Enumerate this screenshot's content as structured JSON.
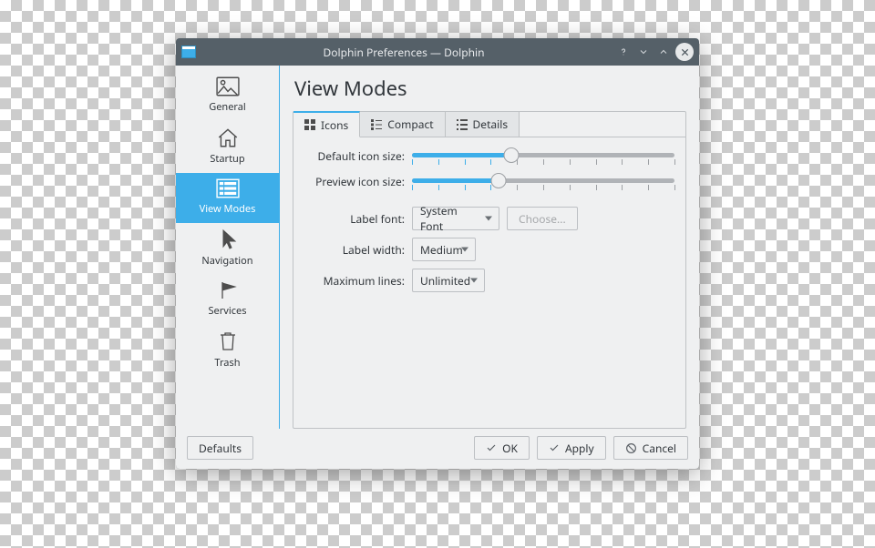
{
  "window": {
    "title": "Dolphin Preferences — Dolphin"
  },
  "sidebar": {
    "items": [
      {
        "label": "General"
      },
      {
        "label": "Startup"
      },
      {
        "label": "View Modes"
      },
      {
        "label": "Navigation"
      },
      {
        "label": "Services"
      },
      {
        "label": "Trash"
      }
    ]
  },
  "main": {
    "heading": "View Modes",
    "tabs": [
      {
        "label": "Icons"
      },
      {
        "label": "Compact"
      },
      {
        "label": "Details"
      }
    ],
    "fields": {
      "default_icon_size_label": "Default icon size:",
      "preview_icon_size_label": "Preview icon size:",
      "label_font_label": "Label font:",
      "label_font_value": "System Font",
      "choose_button": "Choose...",
      "label_width_label": "Label width:",
      "label_width_value": "Medium",
      "max_lines_label": "Maximum lines:",
      "max_lines_value": "Unlimited"
    },
    "sliders": {
      "default_icon_size": {
        "percent": 38,
        "ticks": 11
      },
      "preview_icon_size": {
        "percent": 33,
        "ticks": 11
      }
    }
  },
  "footer": {
    "defaults": "Defaults",
    "ok": "OK",
    "apply": "Apply",
    "cancel": "Cancel"
  }
}
